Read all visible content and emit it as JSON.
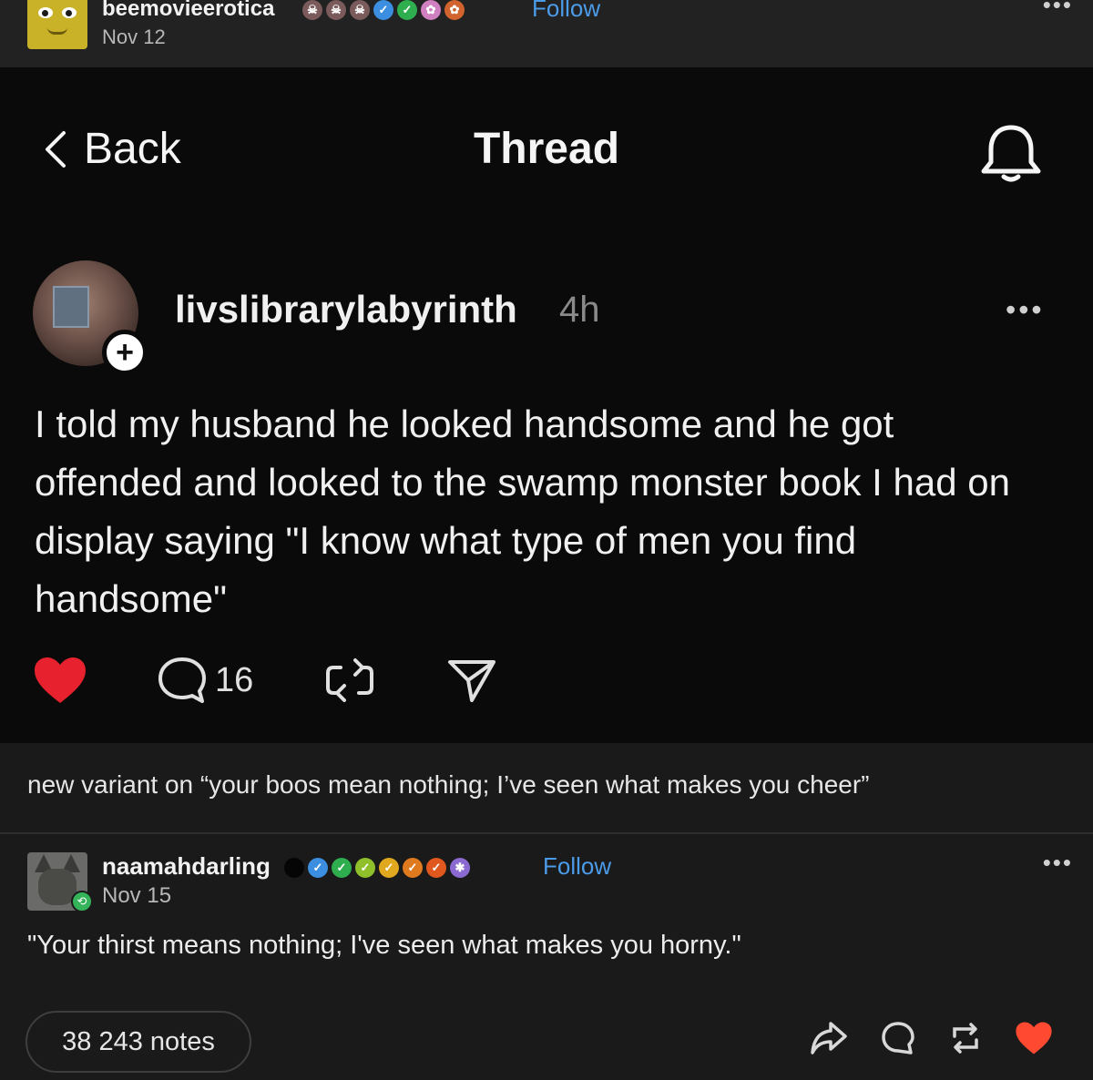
{
  "top_post": {
    "username": "beemovieerotica",
    "date": "Nov 12",
    "follow_label": "Follow",
    "badges": [
      {
        "icon": "skull-icon",
        "color": "#7a5a5a"
      },
      {
        "icon": "skull-icon",
        "color": "#7a5a5a"
      },
      {
        "icon": "skull-icon",
        "color": "#7a5a5a"
      },
      {
        "icon": "verified-blue-icon",
        "color": "#3b8ee0"
      },
      {
        "icon": "verified-green-icon",
        "color": "#2eae4e"
      },
      {
        "icon": "paw-icon",
        "color": "#d07fc0"
      },
      {
        "icon": "paw-orange-icon",
        "color": "#d0632e"
      }
    ]
  },
  "embed": {
    "back_label": "Back",
    "title": "Thread",
    "username": "livslibrarylabyrinth",
    "time": "4h",
    "body": "I told my husband he looked handsome and he got offended and looked to the swamp monster book I had on display saying \"I know what type of men you find handsome\"",
    "comment_count": "16",
    "like_color": "#e8212f"
  },
  "caption": "new variant on “your boos mean nothing; I’ve seen what makes you cheer”",
  "reply": {
    "username": "naamahdarling",
    "date": "Nov 15",
    "follow_label": "Follow",
    "body": "\"Your thirst means nothing; I've seen what makes you horny.\"",
    "badges": [
      {
        "icon": "black-dot-icon",
        "color": "#050505"
      },
      {
        "icon": "verified-blue-icon",
        "color": "#3b8ee0"
      },
      {
        "icon": "verified-green-icon",
        "color": "#2eae4e"
      },
      {
        "icon": "verified-lime-icon",
        "color": "#8fbf2a"
      },
      {
        "icon": "verified-yellow-icon",
        "color": "#e0a81e"
      },
      {
        "icon": "verified-orange-icon",
        "color": "#e07a1e"
      },
      {
        "icon": "verified-red-orange-icon",
        "color": "#e0581e"
      },
      {
        "icon": "crab-icon",
        "color": "#8a6ad0"
      }
    ]
  },
  "footer": {
    "notes_label": "38 243 notes",
    "like_color": "#ff4930"
  }
}
